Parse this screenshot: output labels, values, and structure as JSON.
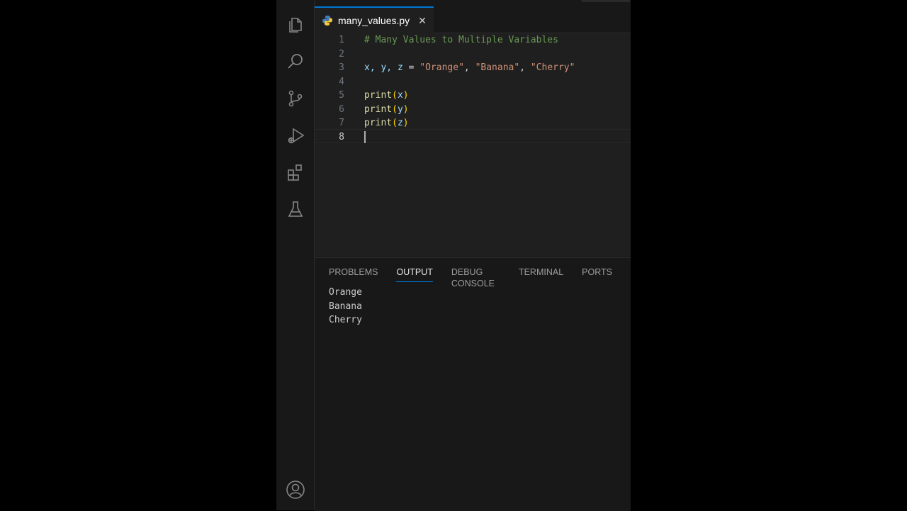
{
  "tab": {
    "filename": "many_values.py",
    "close_glyph": "✕"
  },
  "editor": {
    "line_numbers": [
      "1",
      "2",
      "3",
      "4",
      "5",
      "6",
      "7",
      "8"
    ],
    "comment": "# Many Values to Multiple Variables",
    "assign": {
      "lhs": "x, y, z",
      "op": " = ",
      "s1": "\"Orange\"",
      "s2": "\"Banana\"",
      "s3": "\"Cherry\"",
      "sep": ", "
    },
    "print_fn": "print",
    "args": [
      "x",
      "y",
      "z"
    ]
  },
  "panel": {
    "tabs": [
      "PROBLEMS",
      "OUTPUT",
      "DEBUG CONSOLE",
      "TERMINAL",
      "PORTS"
    ],
    "active_tab": "OUTPUT",
    "output_lines": [
      "Orange",
      "Banana",
      "Cherry"
    ]
  },
  "activity_icons": [
    "explorer-icon",
    "search-icon",
    "source-control-icon",
    "run-debug-icon",
    "extensions-icon",
    "testing-icon",
    "account-icon"
  ],
  "colors": {
    "accent": "#0078d4",
    "comment": "#6a9955",
    "string": "#ce9178",
    "function": "#dcdcaa"
  }
}
